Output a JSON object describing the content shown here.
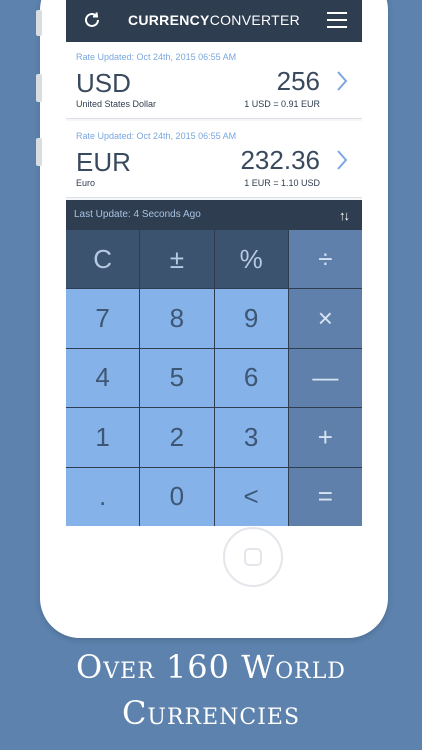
{
  "header": {
    "title_bold": "CURRENCY",
    "title_light": "CONVERTER"
  },
  "cards": [
    {
      "updated": "Rate Updated: Oct 24th, 2015 06:55 AM",
      "code": "USD",
      "name": "United States Dollar",
      "amount": "256",
      "rate": "1 USD = 0.91 EUR"
    },
    {
      "updated": "Rate Updated: Oct 24th, 2015 06:55 AM",
      "code": "EUR",
      "name": "Euro",
      "amount": "232.36",
      "rate": "1 EUR = 1.10 USD"
    }
  ],
  "status": {
    "text": "Last Update: 4 Seconds Ago",
    "swap": "↑↓"
  },
  "keys": {
    "clear": "C",
    "plusminus": "±",
    "percent": "%",
    "divide": "÷",
    "k7": "7",
    "k8": "8",
    "k9": "9",
    "multiply": "×",
    "k4": "4",
    "k5": "5",
    "k6": "6",
    "minus": "—",
    "k1": "1",
    "k2": "2",
    "k3": "3",
    "plus": "+",
    "dot": ".",
    "k0": "0",
    "back": "<",
    "equals": "="
  },
  "caption": {
    "line1": "Over 160 World",
    "line2": "Currencies"
  }
}
